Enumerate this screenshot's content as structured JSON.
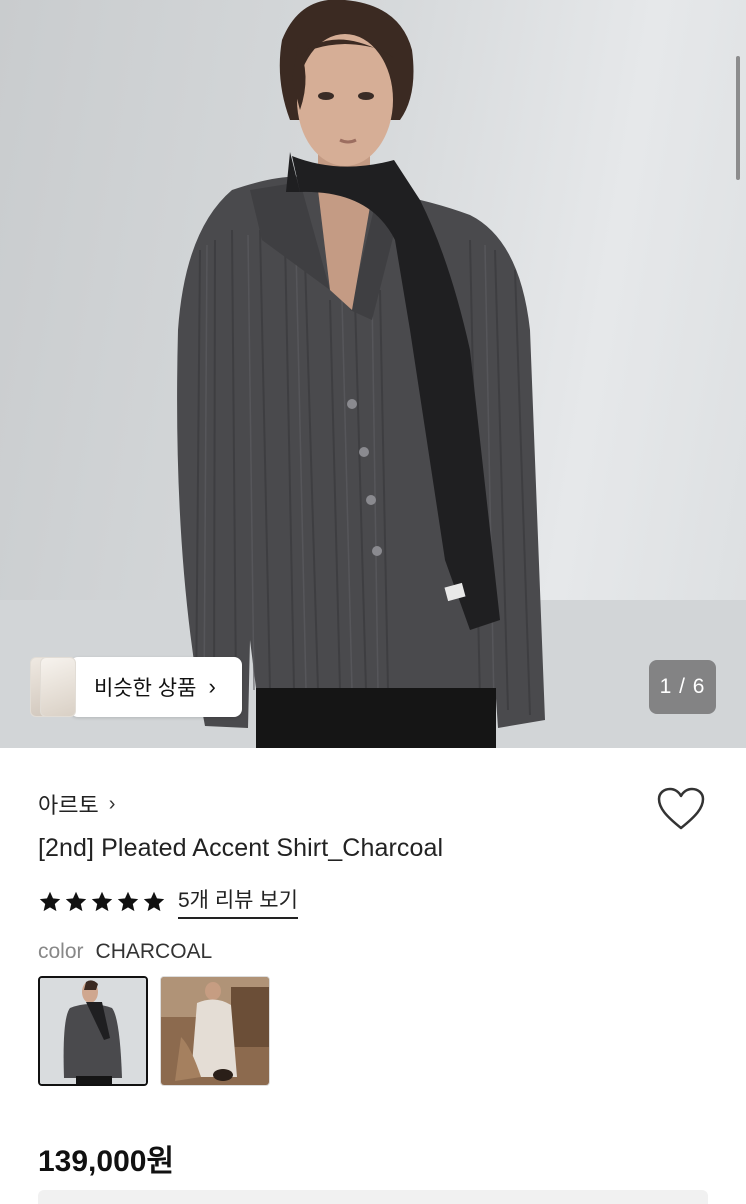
{
  "hero": {
    "counter": "1 / 6",
    "similar_label": "비슷한 상품",
    "similar_chevron": "›"
  },
  "product": {
    "brand": "아르토",
    "brand_chevron": "›",
    "title": "[2nd] Pleated Accent Shirt_Charcoal",
    "rating_stars": 5,
    "review_link": "5개 리뷰 보기",
    "color_label": "color",
    "color_value": "CHARCOAL",
    "price": "139,000원"
  },
  "icons": {
    "heart": "heart-outline-icon",
    "star": "star-filled-icon"
  },
  "colors": {
    "accent": "#111111",
    "shirt": "#4a4a4d",
    "wall": "#d6d9db"
  }
}
